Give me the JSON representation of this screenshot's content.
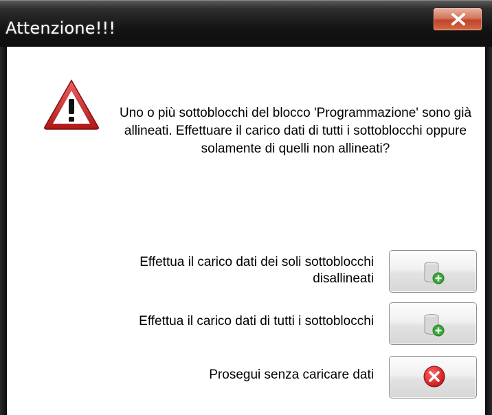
{
  "window": {
    "title": "Attenzione!!!",
    "close_icon": "close-icon"
  },
  "dialog": {
    "icon": "warning-icon",
    "message": "Uno o più sottoblocchi del blocco 'Programmazione' sono già allineati. Effettuare il carico dati di tutti i sottoblocchi oppure solamente di quelli non allineati?",
    "options": [
      {
        "label": "Effettua il carico dati dei soli sottoblocchi disallineati",
        "icon": "database-add-icon"
      },
      {
        "label": "Effettua il carico dati di tutti i sottoblocchi",
        "icon": "database-add-icon"
      },
      {
        "label": "Prosegui senza caricare dati",
        "icon": "cancel-icon"
      }
    ]
  },
  "colors": {
    "warning_red": "#d42a2a",
    "cancel_red": "#d81c1c",
    "add_green": "#3aa83a"
  }
}
